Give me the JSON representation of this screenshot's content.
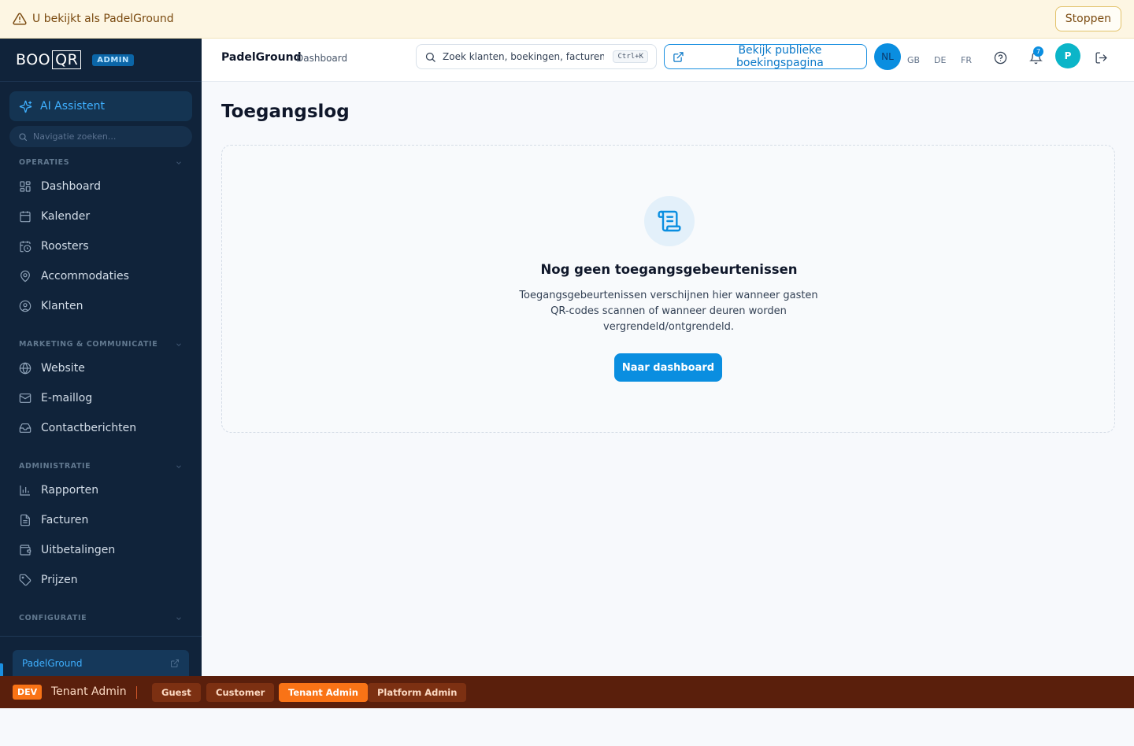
{
  "impersonation": {
    "message": "U bekijkt als PadelGround",
    "stop_label": "Stoppen"
  },
  "sidebar": {
    "logo_text_a": "BOO",
    "logo_text_b": "QR",
    "admin_badge": "ADMIN",
    "ai_assistant": "AI Assistent",
    "nav_search_placeholder": "Navigatie zoeken...",
    "sections": [
      {
        "title": "OPERATIES",
        "items": [
          "Dashboard",
          "Kalender",
          "Roosters",
          "Accommodaties",
          "Klanten"
        ]
      },
      {
        "title": "MARKETING & COMMUNICATIE",
        "items": [
          "Website",
          "E-maillog",
          "Contactberichten"
        ]
      },
      {
        "title": "ADMINISTRATIE",
        "items": [
          "Rapporten",
          "Facturen",
          "Uitbetalingen",
          "Prijzen"
        ]
      },
      {
        "title": "CONFIGURATIE",
        "items": []
      }
    ],
    "tenant": "PadelGround"
  },
  "topbar": {
    "tenant": "PadelGround",
    "page": "Dashboard",
    "search_placeholder": "Zoek klanten, boekingen, facturen...",
    "search_shortcut": "Ctrl+K",
    "public_page_label": "Bekijk publieke boekingspagina",
    "languages": [
      "NL",
      "GB",
      "DE",
      "FR"
    ],
    "active_language": "NL",
    "notification_count": "7",
    "avatar_initial": "P"
  },
  "main": {
    "title": "Toegangslog",
    "empty_title": "Nog geen toegangsgebeurtenissen",
    "empty_description": "Toegangsgebeurtenissen verschijnen hier wanneer gasten QR-codes scannen of wanneer deuren worden vergrendeld/ontgrendeld.",
    "cta_label": "Naar dashboard"
  },
  "devbar": {
    "tag": "DEV",
    "current_role": "Tenant Admin",
    "roles": [
      "Guest",
      "Customer",
      "Tenant Admin",
      "Platform Admin"
    ],
    "active_role": "Tenant Admin"
  },
  "colors": {
    "accent": "#0a8ee0",
    "sidebar_bg": "#10233a",
    "dev_bar": "#5a1f0c",
    "dev_active": "#f97316",
    "banner_bg": "#fdf6e3"
  }
}
